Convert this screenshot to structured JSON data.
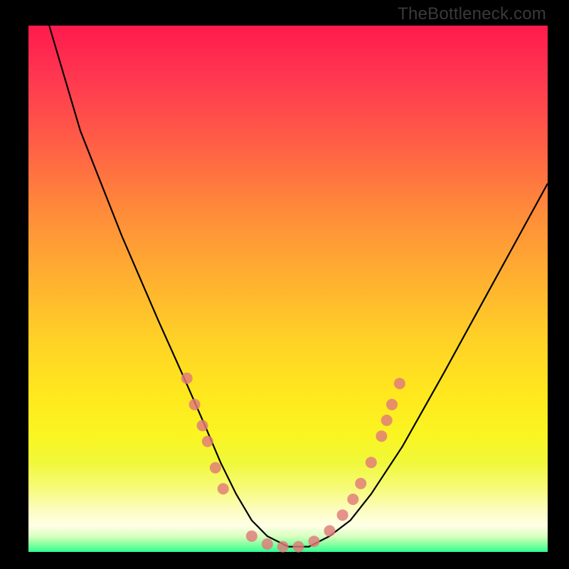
{
  "watermark_text": "TheBottleneck.com",
  "colors": {
    "gradient_top": "#ff1a4d",
    "gradient_bottom": "#2fff95",
    "curve": "#000000",
    "dot_fill": "#e07a7a",
    "page_bg": "#000000"
  },
  "chart_data": {
    "type": "line",
    "title": "",
    "xlabel": "",
    "ylabel": "",
    "xlim": [
      0,
      100
    ],
    "ylim": [
      0,
      100
    ],
    "grid": false,
    "legend": false,
    "series": [
      {
        "name": "bottleneck-curve",
        "x": [
          4,
          10,
          18,
          25,
          30,
          34,
          37,
          40,
          43,
          46,
          50,
          54,
          58,
          62,
          66,
          72,
          80,
          90,
          100
        ],
        "y": [
          100,
          80,
          60,
          44,
          33,
          24,
          17,
          11,
          6,
          3,
          1,
          1,
          3,
          6,
          11,
          20,
          34,
          52,
          70
        ]
      }
    ],
    "markers": [
      {
        "x": 30.5,
        "y": 33
      },
      {
        "x": 32.0,
        "y": 28
      },
      {
        "x": 33.5,
        "y": 24
      },
      {
        "x": 34.5,
        "y": 21
      },
      {
        "x": 36.0,
        "y": 16
      },
      {
        "x": 37.5,
        "y": 12
      },
      {
        "x": 43.0,
        "y": 3
      },
      {
        "x": 46.0,
        "y": 1.5
      },
      {
        "x": 49.0,
        "y": 1
      },
      {
        "x": 52.0,
        "y": 1
      },
      {
        "x": 55.0,
        "y": 2
      },
      {
        "x": 58.0,
        "y": 4
      },
      {
        "x": 60.5,
        "y": 7
      },
      {
        "x": 62.5,
        "y": 10
      },
      {
        "x": 64.0,
        "y": 13
      },
      {
        "x": 66.0,
        "y": 17
      },
      {
        "x": 68.0,
        "y": 22
      },
      {
        "x": 69.0,
        "y": 25
      },
      {
        "x": 70.0,
        "y": 28
      },
      {
        "x": 71.5,
        "y": 32
      }
    ]
  }
}
